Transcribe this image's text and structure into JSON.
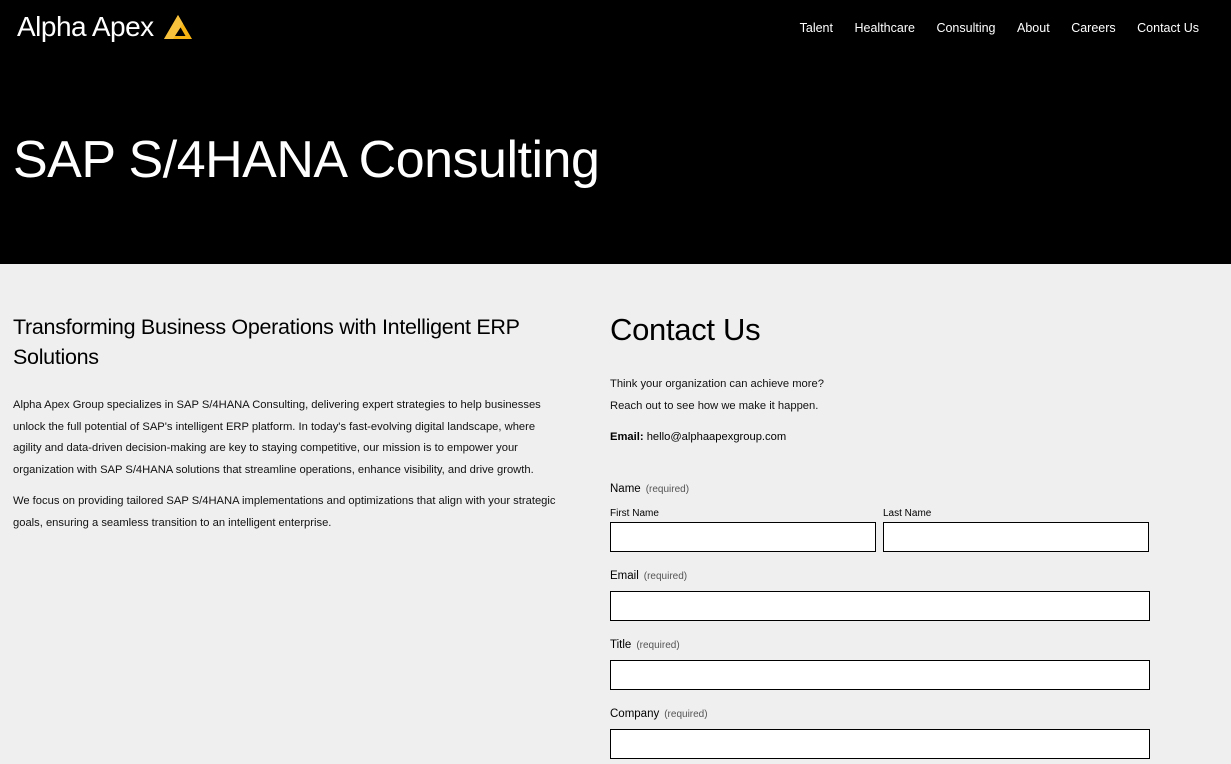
{
  "brand": {
    "name": "Alpha Apex",
    "accent_color": "#f6b312",
    "icon": "apex-logo-icon"
  },
  "nav": {
    "items": [
      {
        "label": "Talent"
      },
      {
        "label": "Healthcare"
      },
      {
        "label": "Consulting"
      },
      {
        "label": "About"
      },
      {
        "label": "Careers"
      },
      {
        "label": "Contact Us"
      }
    ]
  },
  "hero": {
    "title": "SAP S/4HANA Consulting"
  },
  "intro": {
    "heading": "Transforming Business Operations with Intelligent ERP Solutions",
    "paragraphs": [
      "Alpha Apex Group specializes in SAP S/4HANA Consulting, delivering expert strategies to help businesses unlock the full potential of SAP's intelligent ERP platform. In today's fast-evolving digital landscape, where agility and data-driven decision-making are key to staying competitive, our mission is to empower your organization with SAP S/4HANA solutions that streamline operations, enhance visibility, and drive growth.",
      "We focus on providing tailored SAP S/4HANA implementations and optimizations that align with your strategic goals, ensuring a seamless transition to an intelligent enterprise."
    ]
  },
  "contact": {
    "heading": "Contact Us",
    "tagline_1": "Think your organization can achieve more?",
    "tagline_2": "Reach out to see how we make it happen.",
    "email_label": "Email:",
    "email_value": "hello@alphaapexgroup.com",
    "form": {
      "required_text": "(required)",
      "name_label": "Name",
      "first_name_label": "First Name",
      "first_name_value": "",
      "last_name_label": "Last Name",
      "last_name_value": "",
      "email_label": "Email",
      "email_value": "",
      "title_label": "Title",
      "title_value": "",
      "company_label": "Company",
      "company_value": ""
    }
  }
}
